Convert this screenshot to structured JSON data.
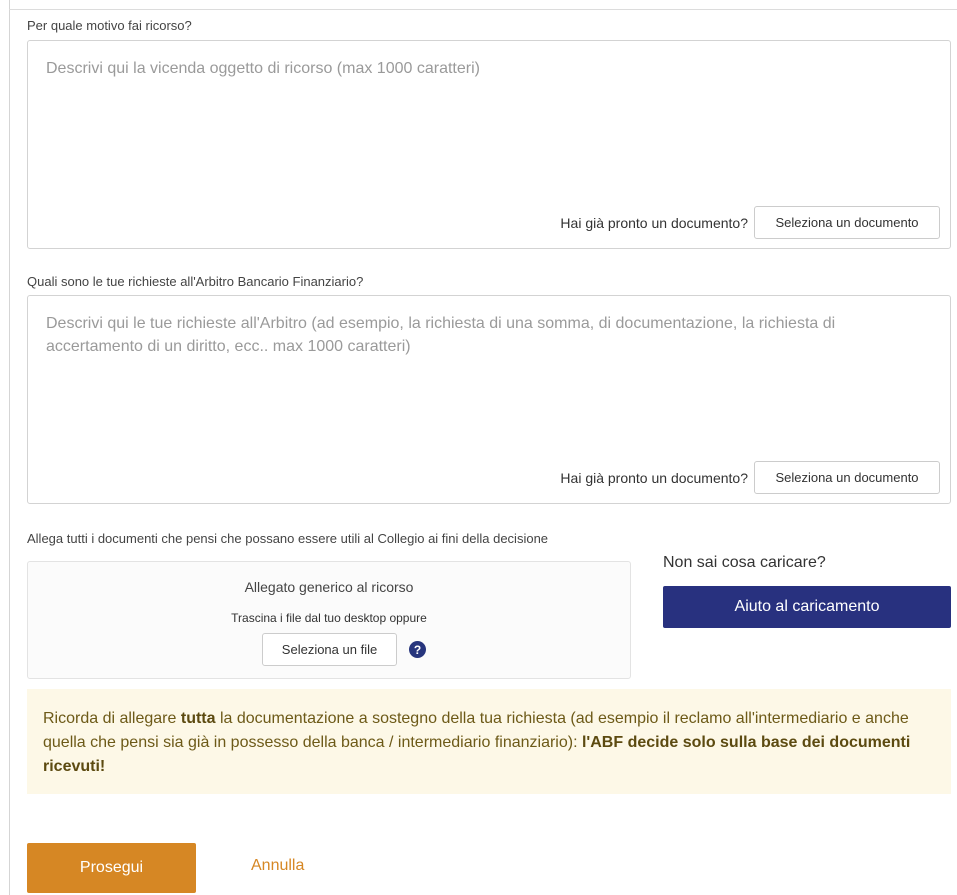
{
  "reason": {
    "label": "Per quale motivo fai ricorso?",
    "placeholder": "Descrivi qui la vicenda oggetto di ricorso (max 1000 caratteri)",
    "value": "",
    "doc_question": "Hai già pronto un documento?",
    "doc_button": "Seleziona un documento"
  },
  "requests": {
    "label": "Quali sono le tue richieste all'Arbitro Bancario Finanziario?",
    "placeholder": "Descrivi qui le tue richieste all'Arbitro (ad esempio, la richiesta di una somma, di documentazione, la richiesta di accertamento di un diritto, ecc.. max 1000 caratteri)",
    "value": "",
    "doc_question": "Hai già pronto un documento?",
    "doc_button": "Seleziona un documento"
  },
  "attachments": {
    "label": "Allega tutti i documenti che pensi che possano essere utili al Collegio ai fini della decisione",
    "dropzone_title": "Allegato generico al ricorso",
    "dropzone_hint": "Trascina i file dal tuo desktop oppure",
    "select_file_button": "Seleziona un file",
    "help_glyph": "?",
    "help_icon": "question-circle-icon"
  },
  "upload_help": {
    "question": "Non sai cosa caricare?",
    "button": "Aiuto al caricamento"
  },
  "notice": {
    "part1": "Ricorda di allegare ",
    "bold1": "tutta",
    "part2": " la documentazione a sostegno della tua richiesta (ad esempio il reclamo all'intermediario e anche quella che pensi sia già in possesso della banca / intermediario finanziario): ",
    "bold2": "l'ABF decide solo sulla base dei documenti ricevuti!"
  },
  "actions": {
    "continue": "Prosegui",
    "cancel": "Annulla"
  },
  "colors": {
    "primary": "#d68724",
    "navy": "#28317f",
    "notice_bg": "#fdf8e7"
  }
}
